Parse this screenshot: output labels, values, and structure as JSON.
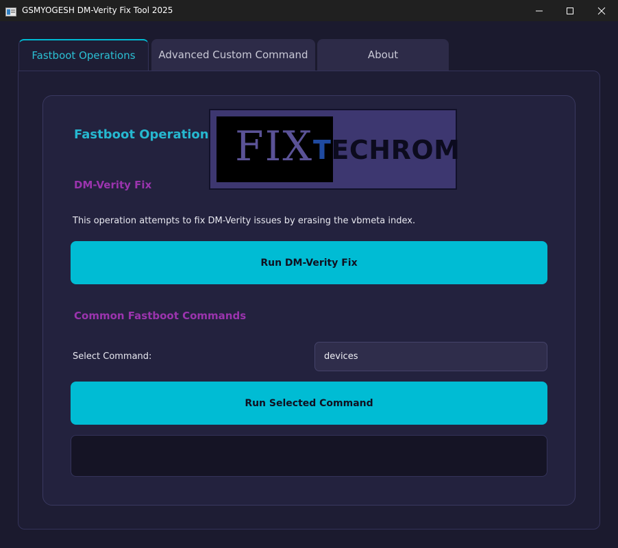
{
  "window": {
    "title": "GSMYOGESH DM-Verity Fix Tool 2025",
    "icons": {
      "minimize": "minimize-icon",
      "maximize": "maximize-icon",
      "close": "close-icon"
    }
  },
  "tabs": [
    {
      "label": "Fastboot Operations",
      "active": true
    },
    {
      "label": "Advanced Custom Command",
      "active": false
    },
    {
      "label": "About",
      "active": false
    }
  ],
  "main": {
    "section_title": "Fastboot Operations",
    "logo": {
      "part1": "FIX",
      "part2_first": "T",
      "part2_rest": "ECHROM"
    },
    "dm_verity": {
      "heading": "DM-Verity Fix",
      "description": "This operation attempts to fix DM-Verity issues by erasing the vbmeta index.",
      "button_label": "Run DM-Verity Fix"
    },
    "common_commands": {
      "heading": "Common Fastboot Commands",
      "select_label": "Select Command:",
      "selected_value": "devices",
      "button_label": "Run Selected Command",
      "output": ""
    }
  },
  "colors": {
    "accent": "#00bcd4",
    "heading_purple": "#9b34ae",
    "background": "#1b1a2e",
    "card": "#23223e"
  }
}
